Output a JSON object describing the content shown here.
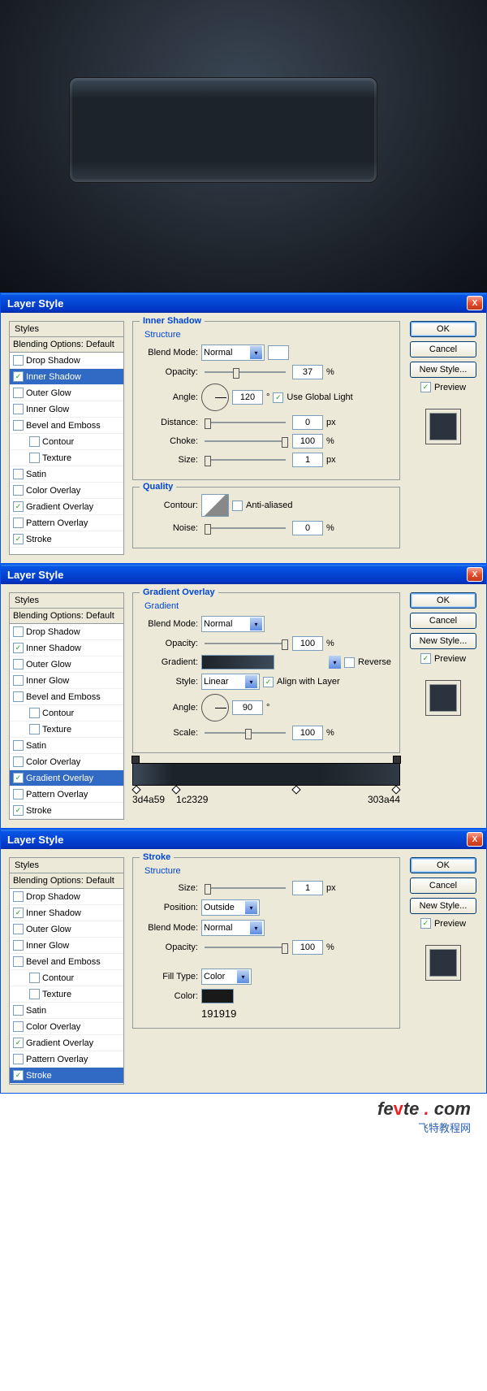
{
  "preview": {
    "colors": [
      "#3d4a59",
      "#1c2329",
      "#303a44"
    ],
    "stroke": "#191919"
  },
  "titlebar": {
    "title": "Layer Style",
    "close": "X"
  },
  "styles_list": {
    "header": "Styles",
    "blending": "Blending Options: Default",
    "items": [
      {
        "label": "Drop Shadow",
        "checked": false
      },
      {
        "label": "Inner Shadow",
        "checked": true
      },
      {
        "label": "Outer Glow",
        "checked": false
      },
      {
        "label": "Inner Glow",
        "checked": false
      },
      {
        "label": "Bevel and Emboss",
        "checked": false
      },
      {
        "label": "Contour",
        "checked": false,
        "indent": true
      },
      {
        "label": "Texture",
        "checked": false,
        "indent": true
      },
      {
        "label": "Satin",
        "checked": false
      },
      {
        "label": "Color Overlay",
        "checked": false
      },
      {
        "label": "Gradient Overlay",
        "checked": true
      },
      {
        "label": "Pattern Overlay",
        "checked": false
      },
      {
        "label": "Stroke",
        "checked": true
      }
    ]
  },
  "buttons": {
    "ok": "OK",
    "cancel": "Cancel",
    "new_style": "New Style...",
    "preview": "Preview"
  },
  "panel_inner_shadow": {
    "title": "Inner Shadow",
    "structure": "Structure",
    "blend_mode_label": "Blend Mode:",
    "blend_mode": "Normal",
    "opacity_label": "Opacity:",
    "opacity": "37",
    "angle_label": "Angle:",
    "angle": "120",
    "use_global": "Use Global Light",
    "distance_label": "Distance:",
    "distance": "0",
    "choke_label": "Choke:",
    "choke": "100",
    "size_label": "Size:",
    "size": "1",
    "quality": "Quality",
    "contour_label": "Contour:",
    "anti_aliased": "Anti-aliased",
    "noise_label": "Noise:",
    "noise": "0",
    "px": "px",
    "pct": "%",
    "deg": "°"
  },
  "panel_gradient": {
    "title": "Gradient Overlay",
    "gradient_sub": "Gradient",
    "blend_mode_label": "Blend Mode:",
    "blend_mode": "Normal",
    "opacity_label": "Opacity:",
    "opacity": "100",
    "gradient_label": "Gradient:",
    "reverse": "Reverse",
    "style_label": "Style:",
    "style": "Linear",
    "align": "Align with Layer",
    "angle_label": "Angle:",
    "angle": "90",
    "scale_label": "Scale:",
    "scale": "100",
    "pct": "%",
    "deg": "°",
    "stops": [
      "3d4a59",
      "1c2329",
      "303a44"
    ]
  },
  "panel_stroke": {
    "title": "Stroke",
    "structure": "Structure",
    "size_label": "Size:",
    "size": "1",
    "px": "px",
    "position_label": "Position:",
    "position": "Outside",
    "blend_mode_label": "Blend Mode:",
    "blend_mode": "Normal",
    "opacity_label": "Opacity:",
    "opacity": "100",
    "pct": "%",
    "fill_type_label": "Fill Type:",
    "fill_type": "Color",
    "color_label": "Color:",
    "color_hex": "191919"
  },
  "watermark": {
    "brand_a": "fe",
    "brand_b": "v",
    "brand_c": "te",
    "dot": " . ",
    "com": "com",
    "sub": "飞特教程网"
  }
}
